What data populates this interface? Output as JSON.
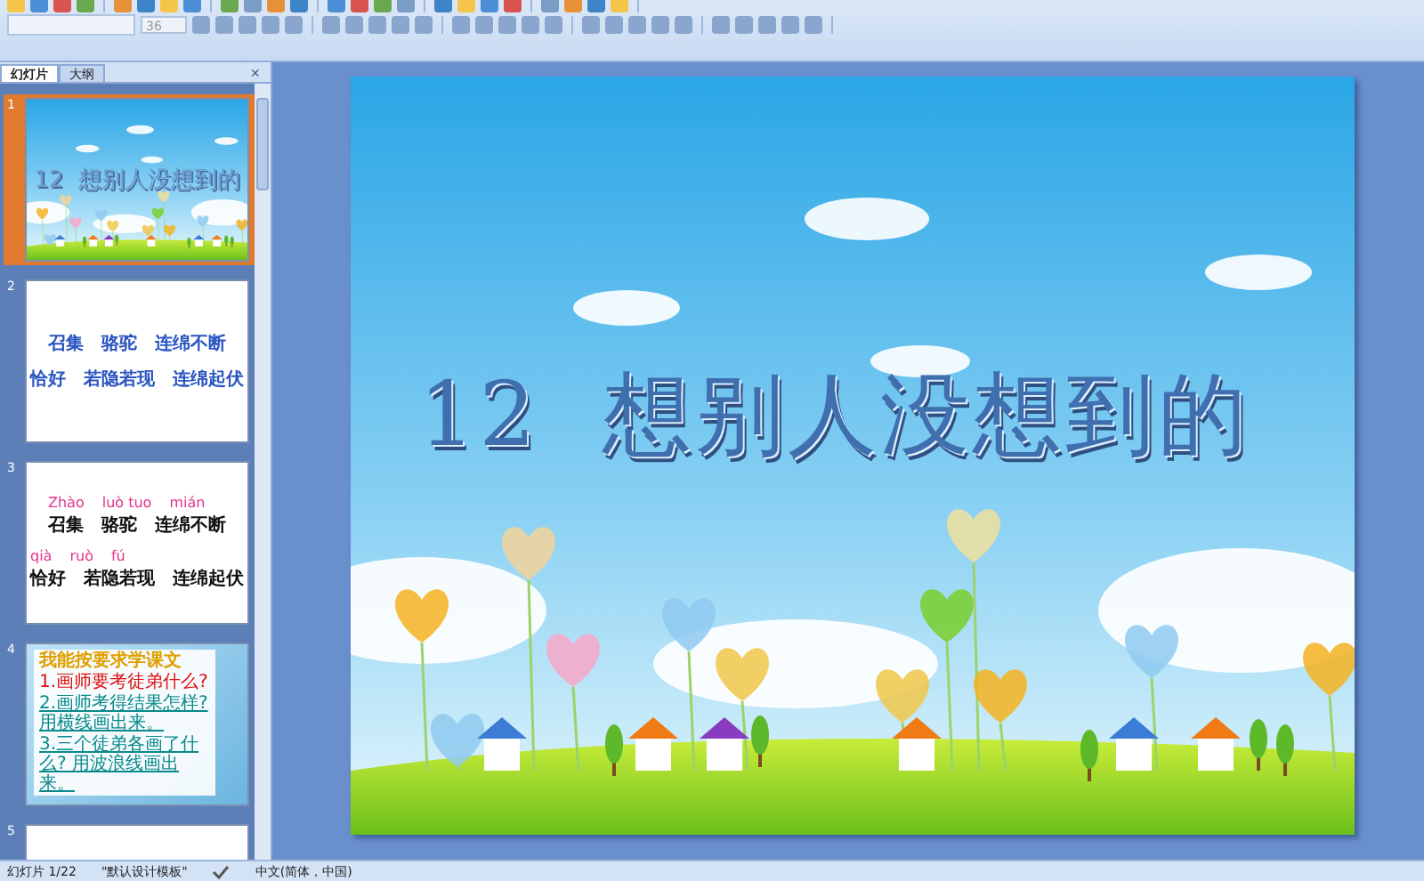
{
  "toolbar": {
    "font_size": "36"
  },
  "panel": {
    "tabs": [
      {
        "label": "幻灯片",
        "selected": true
      },
      {
        "label": "大纲",
        "selected": false
      }
    ],
    "close": "×"
  },
  "slides": [
    {
      "number": "1",
      "kind": "title",
      "selected": true,
      "title": "12  想别人没想到的"
    },
    {
      "number": "2",
      "kind": "words",
      "selected": false,
      "lines": [
        [
          "召集",
          "骆驼",
          "连绵不断"
        ],
        [
          "恰好",
          "若隐若现",
          "连绵起伏"
        ]
      ]
    },
    {
      "number": "3",
      "kind": "pinyin",
      "selected": false,
      "lines": [
        {
          "pinyin": [
            "Zhào",
            "luò tuo",
            "mián"
          ],
          "words": [
            "召集",
            "骆驼",
            "连绵不断"
          ]
        },
        {
          "pinyin": [
            "qià",
            "ruò",
            "fú"
          ],
          "words": [
            "恰好",
            "若隐若现",
            "连绵起伏"
          ]
        }
      ]
    },
    {
      "number": "4",
      "kind": "questions",
      "selected": false,
      "heading": "我能按要求学课文",
      "questions": [
        "1.画师要考徒弟什么?",
        "2.画师考得结果怎样? 用横线画出来。",
        "3.三个徒弟各画了什么? 用波浪线画出来。"
      ]
    },
    {
      "number": "5",
      "kind": "blank",
      "selected": false
    }
  ],
  "main_slide": {
    "title": "12  想别人没想到的"
  },
  "status_bar": {
    "slide": "幻灯片 1/22",
    "template": "\"默认设计模板\"",
    "language": "中文(简体，中国)"
  }
}
